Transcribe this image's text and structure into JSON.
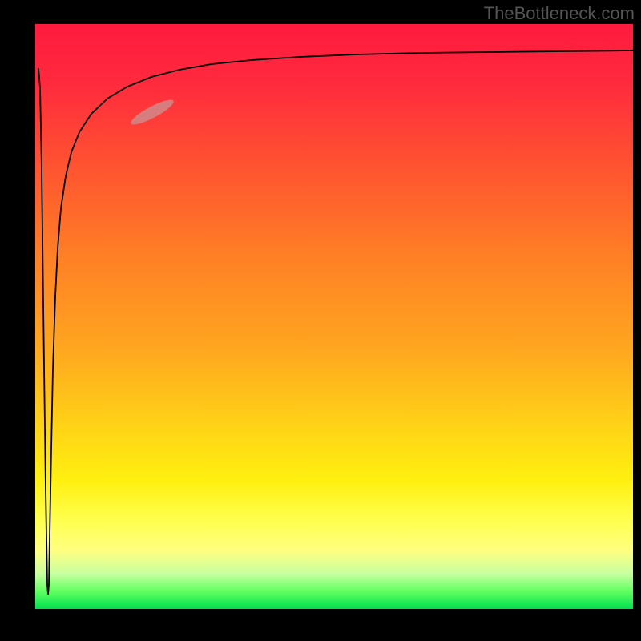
{
  "watermark": "TheBottleneck.com",
  "chart_data": {
    "type": "line",
    "title": "",
    "xlabel": "",
    "ylabel": "",
    "xlim": [
      0,
      100
    ],
    "ylim": [
      0,
      100
    ],
    "note": "Bottleneck-style curve: value drops sharply to ~0 near x≈2 then rises asymptotically toward ~95; values read from vertical position on gradient",
    "series": [
      {
        "name": "bottleneck-curve",
        "x": [
          0.5,
          1,
          1.5,
          2,
          2.2,
          2.5,
          3,
          3.5,
          4,
          5,
          6,
          8,
          10,
          12,
          15,
          18,
          22,
          28,
          35,
          45,
          60,
          80,
          100
        ],
        "y": [
          92,
          70,
          35,
          3,
          5,
          25,
          50,
          62,
          70,
          78,
          82,
          86,
          88,
          89.5,
          91,
          92,
          92.8,
          93.5,
          94,
          94.3,
          94.6,
          94.8,
          95
        ]
      }
    ],
    "highlight": {
      "approx_x_center": 19,
      "approx_y_center": 87,
      "description": "salmon pill-shaped marker on rising curve segment"
    },
    "background_gradient": {
      "orientation": "vertical",
      "stops": [
        {
          "pos": 0,
          "color": "#ff1a3e"
        },
        {
          "pos": 55,
          "color": "#ffa520"
        },
        {
          "pos": 78,
          "color": "#fff010"
        },
        {
          "pos": 100,
          "color": "#00e050"
        }
      ]
    }
  }
}
